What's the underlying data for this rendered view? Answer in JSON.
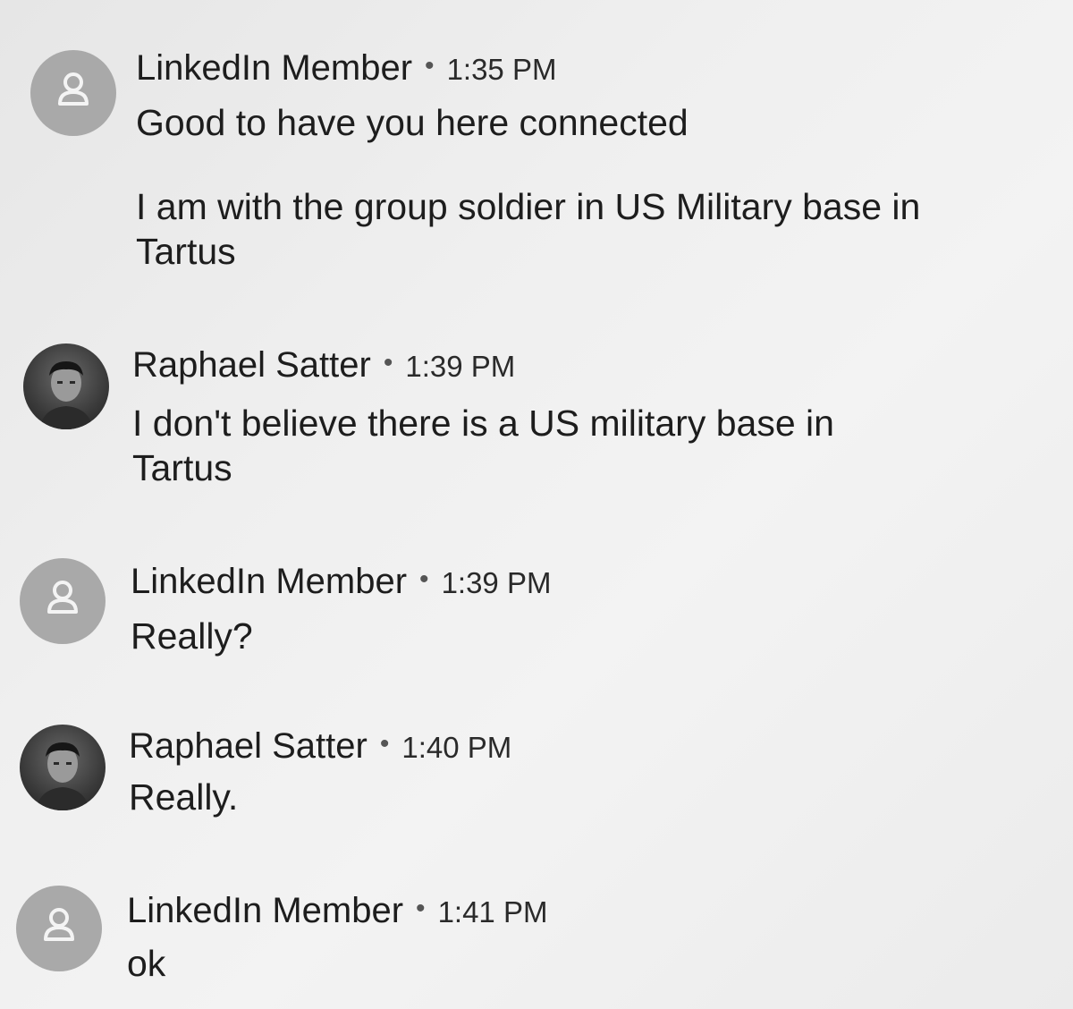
{
  "messages": [
    {
      "sender": "LinkedIn Member",
      "separator": "•",
      "time": "1:35 PM",
      "avatar": "ghost-person-icon",
      "paragraphs": [
        "Good to have you here connected",
        "I am with the group soldier in US Military base in\nTartus"
      ]
    },
    {
      "sender": "Raphael Satter",
      "separator": "•",
      "time": "1:39 PM",
      "avatar": "profile-photo",
      "paragraphs": [
        "I don't believe there is a US military base in\nTartus"
      ]
    },
    {
      "sender": "LinkedIn Member",
      "separator": "•",
      "time": "1:39 PM",
      "avatar": "ghost-person-icon",
      "paragraphs": [
        "Really?"
      ]
    },
    {
      "sender": "Raphael Satter",
      "separator": "•",
      "time": "1:40 PM",
      "avatar": "profile-photo",
      "paragraphs": [
        "Really."
      ]
    },
    {
      "sender": "LinkedIn Member",
      "separator": "•",
      "time": "1:41 PM",
      "avatar": "ghost-person-icon",
      "paragraphs": [
        "ok"
      ]
    }
  ],
  "colors": {
    "background": "#ececec",
    "ghost_avatar": "#a9a9a9",
    "text": "#1d1d1d"
  }
}
